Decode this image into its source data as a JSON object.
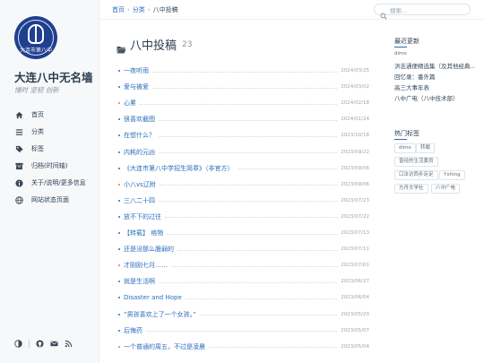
{
  "site": {
    "logo_text": "大连市第八中",
    "title": "大连八中无名墙",
    "subtitle": "惜时 坚韧 创新"
  },
  "nav": [
    {
      "label": "首页",
      "icon": "home-icon"
    },
    {
      "label": "分类",
      "icon": "list-icon"
    },
    {
      "label": "标签",
      "icon": "tag-icon"
    },
    {
      "label": "归档(时间轴)",
      "icon": "archive-icon"
    },
    {
      "label": "关于/说明/更多信息",
      "icon": "info-icon"
    },
    {
      "label": "网站状态页面",
      "icon": "globe-icon"
    }
  ],
  "sidebar_footer": {
    "icons": [
      "theme-toggle-icon",
      "github-icon",
      "email-icon",
      "rss-icon"
    ]
  },
  "breadcrumb": {
    "home": "首页",
    "category": "分类",
    "current": "八中投稿"
  },
  "search": {
    "placeholder": "搜索..."
  },
  "page": {
    "title": "八中投稿",
    "count": "23",
    "icon": "folder-open-icon"
  },
  "posts": [
    {
      "title": "一夜听雨",
      "date": "2024/03/25"
    },
    {
      "title": "爱与被爱",
      "date": "2024/03/02"
    },
    {
      "title": "心累",
      "date": "2024/02/18"
    },
    {
      "title": "很喜欢截图",
      "date": "2024/01/24"
    },
    {
      "title": "在想什么？",
      "date": "2023/10/18"
    },
    {
      "title": "内耗的元凶",
      "date": "2023/09/22"
    },
    {
      "title": "《大连市第八中学招生简章》（非官方）",
      "date": "2023/09/06"
    },
    {
      "title": "小八vs辽附",
      "date": "2023/09/06"
    },
    {
      "title": "三八二十四",
      "date": "2023/07/23"
    },
    {
      "title": "放不下的过往",
      "date": "2023/07/22"
    },
    {
      "title": "【转载】 格物",
      "date": "2023/07/13"
    },
    {
      "title": "还是没那么脆弱的",
      "date": "2023/07/11"
    },
    {
      "title": "才刚刚七月……",
      "date": "2023/07/01"
    },
    {
      "title": "就是生活啊",
      "date": "2023/06/27"
    },
    {
      "title": "Disaster and Hope",
      "date": "2023/06/04"
    },
    {
      "title": "“男孩喜欢上了一个女孩。”",
      "date": "2023/05/20"
    },
    {
      "title": "后悔药",
      "date": "2023/05/07"
    },
    {
      "title": "一个普通的周五，不过是凌晨",
      "date": "2023/05/04"
    }
  ],
  "recent": {
    "heading": "最近更新",
    "items": [
      "dimo",
      "洪志通便精选集（及其他经典...",
      "回忆录：番外篇",
      "高三大事年表",
      "八中广电（八中技术部）"
    ]
  },
  "hot_tags": {
    "heading": "热门标签",
    "tags": [
      "dimo",
      "转载",
      "曾经的生活委员",
      "口法访西步足足",
      "Yxhing",
      "方舟文学社",
      "八中广电"
    ]
  }
}
